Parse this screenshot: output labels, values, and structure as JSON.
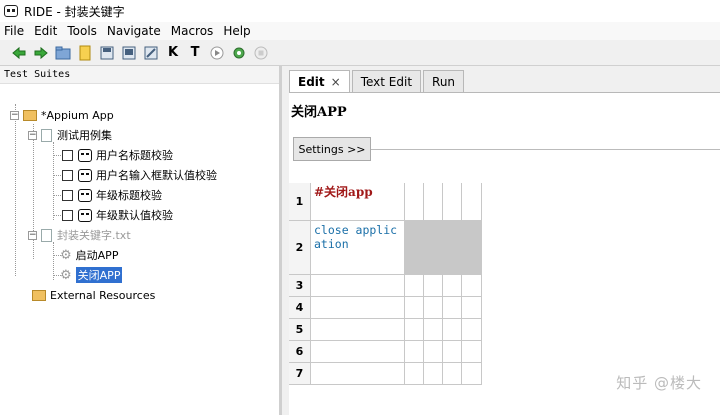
{
  "window": {
    "title": "RIDE - 封装关键字"
  },
  "menu": [
    "File",
    "Edit",
    "Tools",
    "Navigate",
    "Macros",
    "Help"
  ],
  "toolbar": {
    "icons": [
      "back-arrow-icon",
      "forward-arrow-icon",
      "open-folder-icon",
      "new-file-icon",
      "save-icon",
      "save-all-icon",
      "save-as-icon",
      "keyword-search-icon",
      "test-search-icon",
      "run-icon",
      "plugin-icon",
      "stop-icon"
    ],
    "k_label": "K",
    "t_label": "T"
  },
  "tree": {
    "header": "Test Suites",
    "root": "*Appium App",
    "suite": "测试用例集",
    "tests": [
      "用户名标题校验",
      "用户名输入框默认值校验",
      "年级标题校验",
      "年级默认值校验"
    ],
    "resource_file": "封装关键字.txt",
    "keywords": [
      "启动APP",
      "关闭APP"
    ],
    "external": "External Resources"
  },
  "editor": {
    "tabs": [
      "Edit",
      "Text Edit",
      "Run"
    ],
    "close_glyph": "×",
    "keyword_name": "关闭APP",
    "settings_label": "Settings >>",
    "rows": [
      {
        "num": "1",
        "cells": [
          "#关闭app"
        ]
      },
      {
        "num": "2",
        "cells": [
          "close application"
        ]
      },
      {
        "num": "3",
        "cells": [
          ""
        ]
      },
      {
        "num": "4",
        "cells": [
          ""
        ]
      },
      {
        "num": "5",
        "cells": [
          ""
        ]
      },
      {
        "num": "6",
        "cells": [
          ""
        ]
      },
      {
        "num": "7",
        "cells": [
          ""
        ]
      }
    ]
  },
  "watermark": "知乎 @楼大",
  "colors": {
    "selection": "#3070d0",
    "comment": "#a01818",
    "keyword": "#1a6fa8"
  }
}
